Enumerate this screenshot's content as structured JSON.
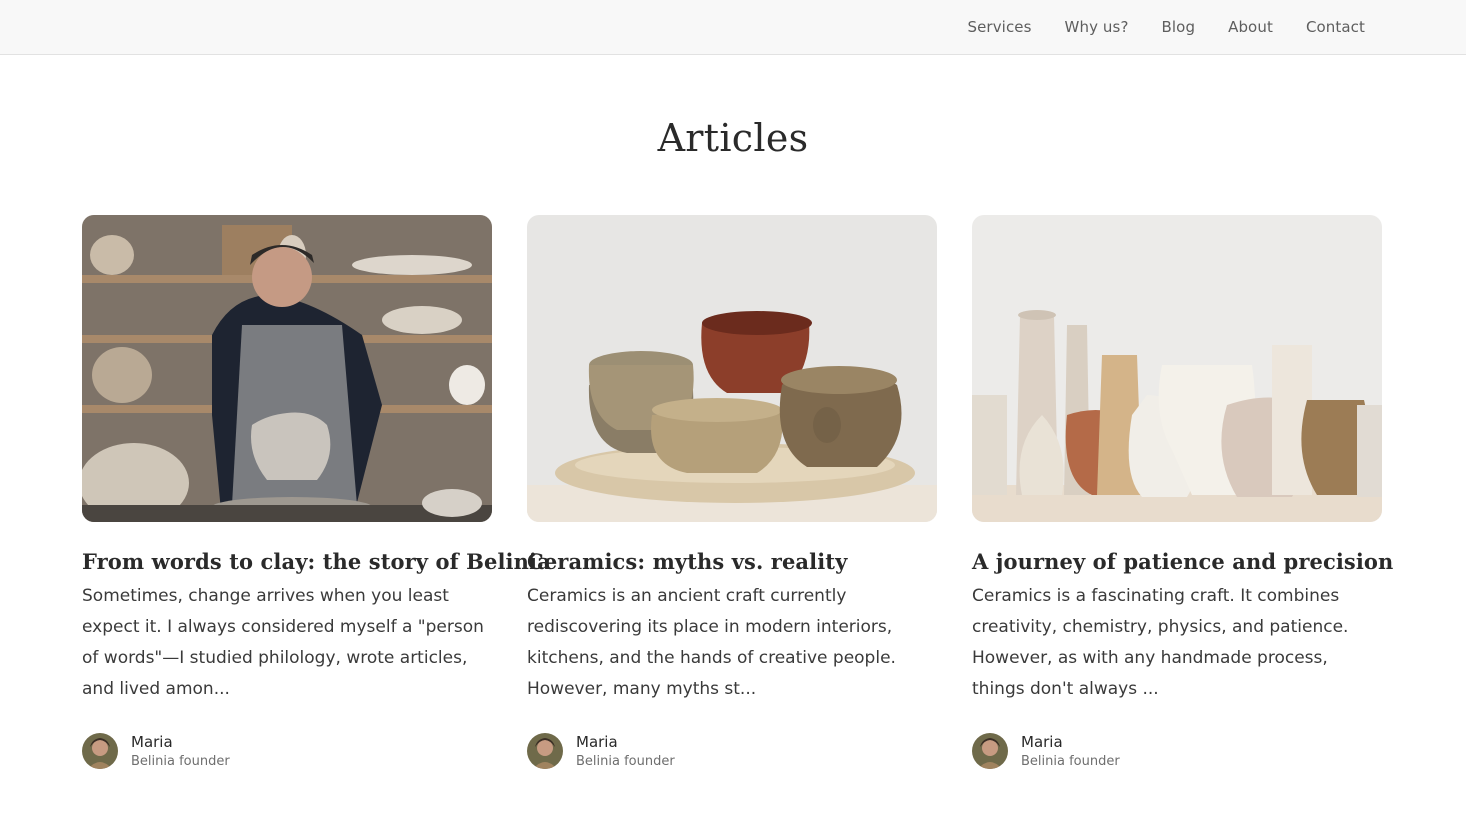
{
  "nav": {
    "items": [
      {
        "label": "Services"
      },
      {
        "label": "Why us?"
      },
      {
        "label": "Blog"
      },
      {
        "label": "About"
      },
      {
        "label": "Contact"
      }
    ]
  },
  "page": {
    "title": "Articles"
  },
  "articles": [
    {
      "title": "From words to clay: the story of Belinia",
      "excerpt": "Sometimes, change arrives when you least expect it. I always considered myself a \"person of words\"—I studied philology, wrote articles, and lived amon...",
      "image_icon": "potter-at-wheel-photo",
      "author": {
        "name": "Maria",
        "role": "Belinia founder"
      }
    },
    {
      "title": "Ceramics: myths vs. reality",
      "excerpt": "Ceramics is an ancient craft currently rediscovering its place in modern interiors, kitchens, and the hands of creative people. However, many myths st...",
      "image_icon": "stacked-bowls-photo",
      "author": {
        "name": "Maria",
        "role": "Belinia founder"
      }
    },
    {
      "title": "A journey of patience and precision",
      "excerpt": "Ceramics is a fascinating craft. It combines creativity, chemistry, physics, and patience. However, as with any handmade process, things don't always ...",
      "image_icon": "vase-collection-photo",
      "author": {
        "name": "Maria",
        "role": "Belinia founder"
      }
    }
  ],
  "colors": {
    "topbar_bg": "#f8f8f8",
    "text_dark": "#2a2a2a",
    "nav_text": "#5e5e5e",
    "muted_text": "#6e6e6e"
  }
}
